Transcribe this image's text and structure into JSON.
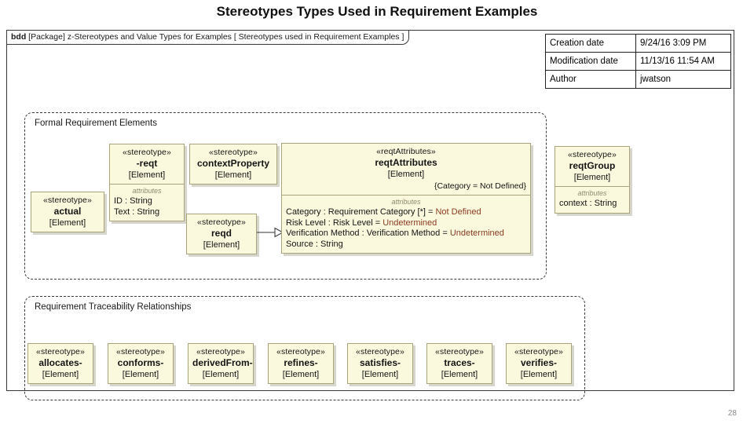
{
  "slide": {
    "title": "Stereotypes Types Used in Requirement Examples",
    "page_number": "28"
  },
  "frame": {
    "keyword": "bdd",
    "label_rest": "[Package] z-Stereotypes and Value Types for Examples [ Stereotypes used in Requirement Examples ]"
  },
  "metadata": {
    "rows": [
      {
        "key": "Creation date",
        "value": "9/24/16 3:09 PM"
      },
      {
        "key": "Modification date",
        "value": "11/13/16 11:54 AM"
      },
      {
        "key": "Author",
        "value": "jwatson"
      }
    ]
  },
  "groups": {
    "formal": {
      "title": "Formal Requirement Elements"
    },
    "traceability": {
      "title": "Requirement Traceability Relationships"
    }
  },
  "nodes": {
    "actual": {
      "stereotype": "«stereotype»",
      "name": "actual",
      "metaclass": "[Element]"
    },
    "reqt": {
      "stereotype": "«stereotype»",
      "name": "-reqt",
      "metaclass": "[Element]",
      "attributes_header": "attributes",
      "attributes": [
        {
          "text": "ID : String"
        },
        {
          "text": "Text : String"
        }
      ]
    },
    "contextProperty": {
      "stereotype": "«stereotype»",
      "name": "contextProperty",
      "metaclass": "[Element]"
    },
    "reqd": {
      "stereotype": "«stereotype»",
      "name": "reqd",
      "metaclass": "[Element]"
    },
    "reqtAttributes": {
      "stereotype": "«reqtAttributes»",
      "name": "reqtAttributes",
      "metaclass": "[Element]",
      "constraint": "{Category = Not Defined}",
      "attributes_header": "attributes",
      "attributes": [
        {
          "label": "Category : Requirement Category [*] = ",
          "default": "Not Defined"
        },
        {
          "label": "Risk Level : Risk Level = ",
          "default": "Undetermined"
        },
        {
          "label": "Verification Method : Verification Method = ",
          "default": "Undetermined"
        },
        {
          "label": "Source : String",
          "default": ""
        }
      ]
    },
    "reqtGroup": {
      "stereotype": "«stereotype»",
      "name": "reqtGroup",
      "metaclass": "[Element]",
      "attributes_header": "attributes",
      "attributes": [
        {
          "text": "context : String"
        }
      ]
    },
    "allocates": {
      "stereotype": "«stereotype»",
      "name": "allocates-",
      "metaclass": "[Element]"
    },
    "conforms": {
      "stereotype": "«stereotype»",
      "name": "conforms-",
      "metaclass": "[Element]"
    },
    "derivedFrom": {
      "stereotype": "«stereotype»",
      "name": "derivedFrom-",
      "metaclass": "[Element]"
    },
    "refines": {
      "stereotype": "«stereotype»",
      "name": "refines-",
      "metaclass": "[Element]"
    },
    "satisfies": {
      "stereotype": "«stereotype»",
      "name": "satisfies-",
      "metaclass": "[Element]"
    },
    "traces": {
      "stereotype": "«stereotype»",
      "name": "traces-",
      "metaclass": "[Element]"
    },
    "verifies": {
      "stereotype": "«stereotype»",
      "name": "verifies-",
      "metaclass": "[Element]"
    }
  },
  "connector": {
    "kind": "generalization",
    "from": "reqd",
    "to": "reqtAttributes"
  },
  "colors": {
    "node_fill": "#FBF9DD",
    "node_border": "#A9A47C",
    "frame_border": "#3A3A3A",
    "default_value_text": "#8A3B22",
    "attributes_header_text": "#8D8A6E"
  }
}
